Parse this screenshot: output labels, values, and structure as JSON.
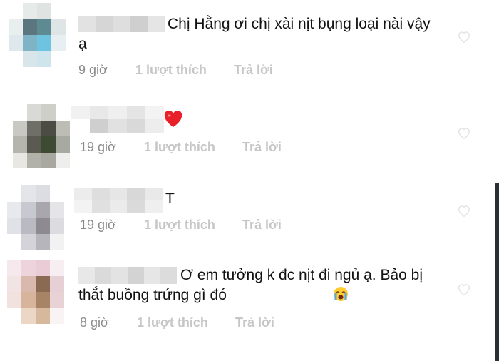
{
  "comments": [
    {
      "text": "Chị Hằng ơi chị xài nịt bụng loại nài vậy ạ",
      "time": "9 giờ",
      "likes": "1 lượt thích",
      "reply": "Trả lời",
      "heart_icon": "heart-outline-icon"
    },
    {
      "text": "",
      "emoji": "heart-emoji",
      "time": "19 giờ",
      "likes": "1 lượt thích",
      "reply": "Trả lời",
      "heart_icon": "heart-outline-icon"
    },
    {
      "text": "T",
      "time": "19 giờ",
      "likes": "1 lượt thích",
      "reply": "Trả lời",
      "heart_icon": "heart-outline-icon"
    },
    {
      "text": "Ơ em tưởng k đc nịt đi ngủ ạ. Bảo bị thắt buồng trứng gì đó",
      "emoji": "crying-face-emoji",
      "time": "8 giờ",
      "likes": "1 lượt thích",
      "reply": "Trả lời",
      "heart_icon": "heart-outline-icon"
    }
  ],
  "colors": {
    "meta_gray": "#9e9e9e",
    "action_gray": "#c6c6c6",
    "text": "#121212",
    "heart_red": "#e8202a"
  }
}
